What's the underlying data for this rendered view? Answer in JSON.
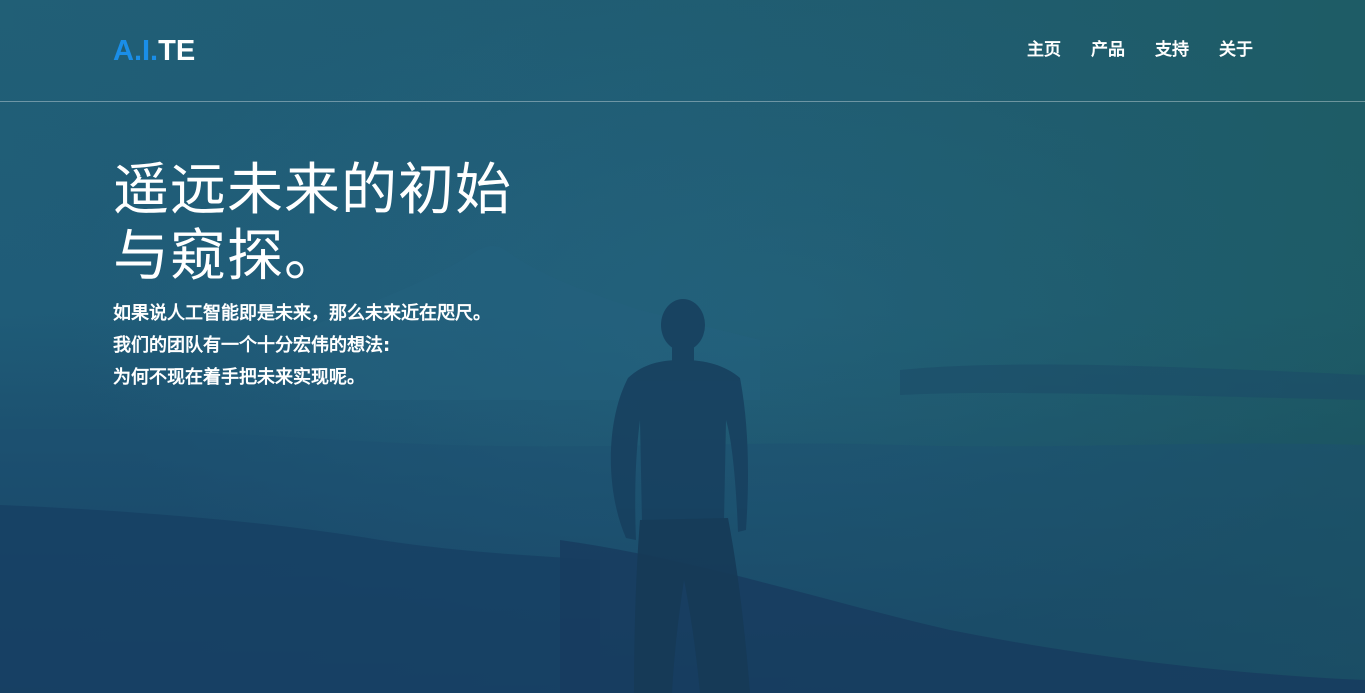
{
  "brand": {
    "logo_accent": "A.I.",
    "logo_rest": "TE",
    "accent_color": "#1a8ee8"
  },
  "nav": {
    "links": [
      "主页",
      "产品",
      "支持",
      "关于"
    ]
  },
  "hero": {
    "title_lines": [
      "遥远未来的初始",
      "与窥探。"
    ],
    "text_lines": [
      "如果说人工智能即是未来，那么未来近在咫尺。",
      "我们的团队有一个十分宏伟的想法:",
      "为何不现在着手把未来实现呢。"
    ],
    "background_tint": "#1d5670"
  }
}
